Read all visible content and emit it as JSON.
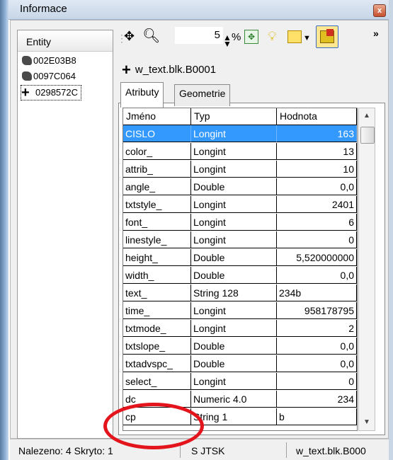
{
  "window": {
    "title": "Informace",
    "close_symbol": "x"
  },
  "entity_panel": {
    "header": "Entity",
    "items": [
      {
        "id": "002E03B8",
        "icon": "polygon-icon"
      },
      {
        "id": "0097C064",
        "icon": "polygon-icon"
      },
      {
        "id": "0298572C",
        "icon": "cross-icon",
        "selected": true
      }
    ]
  },
  "toolbar": {
    "zoom_value": "5",
    "percent": "%",
    "icons": [
      "move-icon",
      "search-icon",
      "spin-icon",
      "zoom-fit-icon",
      "bulb-icon",
      "highlight-icon",
      "dropdown-icon",
      "active-highlight-icon",
      "overflow-icon"
    ]
  },
  "object": {
    "name": "w_text.blk.B0001"
  },
  "tabs": [
    {
      "label": "Atributy",
      "active": true
    },
    {
      "label": "Geometrie",
      "active": false
    }
  ],
  "grid": {
    "columns": [
      "Jméno",
      "Typ",
      "Hodnota"
    ],
    "rows": [
      {
        "name": "CISLO",
        "type": "Longint",
        "value": "163",
        "selected": true
      },
      {
        "name": "color_",
        "type": "Longint",
        "value": "13"
      },
      {
        "name": "attrib_",
        "type": "Longint",
        "value": "10"
      },
      {
        "name": "angle_",
        "type": "Double",
        "value": "0,0"
      },
      {
        "name": "txtstyle_",
        "type": "Longint",
        "value": "2401"
      },
      {
        "name": "font_",
        "type": "Longint",
        "value": "6"
      },
      {
        "name": "linestyle_",
        "type": "Longint",
        "value": "0"
      },
      {
        "name": "height_",
        "type": "Double",
        "value": "5,520000000"
      },
      {
        "name": "width_",
        "type": "Double",
        "value": "0,0"
      },
      {
        "name": "text_",
        "type": "String 128",
        "value": "234b",
        "align_left": true
      },
      {
        "name": "time_",
        "type": "Longint",
        "value": "958178795"
      },
      {
        "name": "txtmode_",
        "type": "Longint",
        "value": "2"
      },
      {
        "name": "txtslope_",
        "type": "Double",
        "value": "0,0"
      },
      {
        "name": "txtadvspc_",
        "type": "Double",
        "value": "0,0"
      },
      {
        "name": "select_",
        "type": "Longint",
        "value": "0"
      },
      {
        "name": "dc",
        "type": "Numeric 4.0",
        "value": "234"
      },
      {
        "name": "cp",
        "type": "String 1",
        "value": "b",
        "align_left": true
      }
    ]
  },
  "statusbar": {
    "found": "Nalezeno: 4 Skryto: 1",
    "system": "S JTSK",
    "object": "w_text.blk.B000"
  },
  "colors": {
    "selection": "#3399ff",
    "annotation": "#e3141b"
  }
}
